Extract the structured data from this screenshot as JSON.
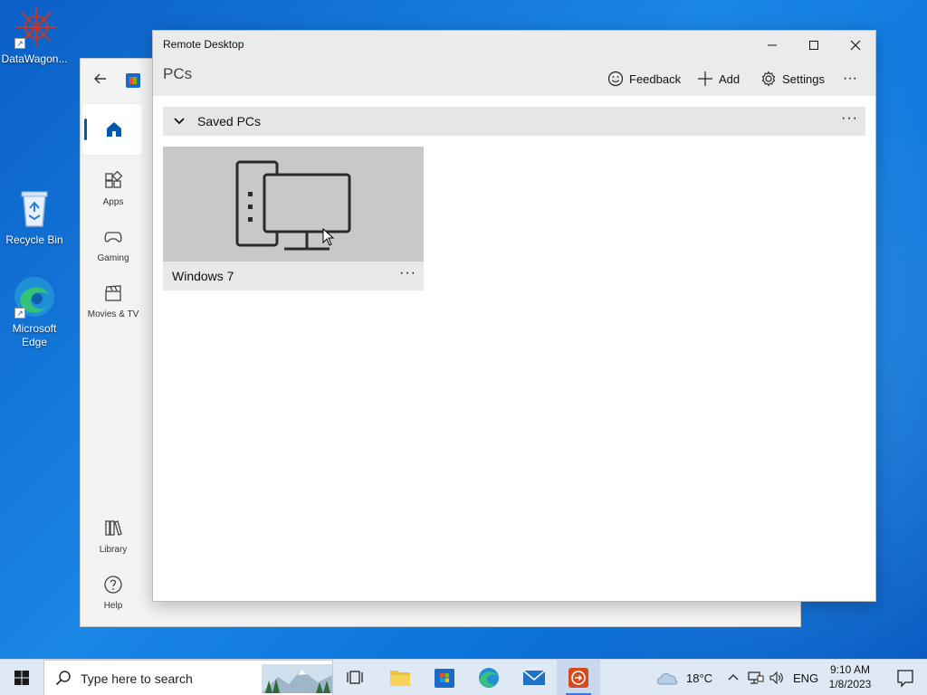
{
  "desktop": {
    "icons": [
      {
        "label": "DataWagon..."
      },
      {
        "label": "Recycle Bin"
      },
      {
        "label": "Microsoft Edge"
      }
    ]
  },
  "store": {
    "nav": [
      {
        "label": "Apps"
      },
      {
        "label": "Gaming"
      },
      {
        "label": "Movies & TV"
      },
      {
        "label": "Library"
      },
      {
        "label": "Help"
      }
    ]
  },
  "rd": {
    "window_title": "Remote Desktop",
    "page_title": "PCs",
    "commands": {
      "feedback": "Feedback",
      "add": "Add",
      "settings": "Settings",
      "more": "···"
    },
    "group": {
      "label": "Saved PCs",
      "more": "···"
    },
    "pcs": [
      {
        "name": "Windows 7",
        "more": "···"
      }
    ]
  },
  "taskbar": {
    "search_placeholder": "Type here to search",
    "weather": "18°C",
    "language": "ENG",
    "time": "9:10 AM",
    "date": "1/8/2023"
  },
  "colors": {
    "accent": "#0058b0",
    "desktop_blue": "#1a86e6",
    "taskbar": "#dfe9f5"
  }
}
